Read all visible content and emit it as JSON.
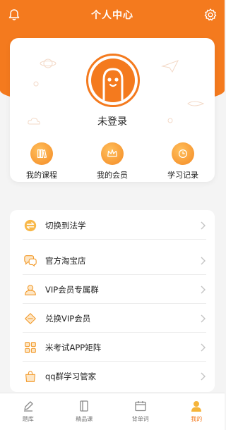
{
  "header": {
    "title": "个人中心",
    "left_icon": "bell-icon",
    "right_icon": "gear-icon"
  },
  "profile": {
    "status": "未登录",
    "quick_links": [
      {
        "label": "我的课程",
        "icon": "books-icon"
      },
      {
        "label": "我的会员",
        "icon": "crown-icon"
      },
      {
        "label": "学习记录",
        "icon": "clock-icon"
      }
    ]
  },
  "menu": {
    "items": [
      {
        "label": "切换到法学",
        "icon": "switch-icon"
      },
      {
        "label": "官方淘宝店",
        "icon": "chat-bubbles-icon"
      },
      {
        "label": "VIP会员专属群",
        "icon": "group-icon"
      },
      {
        "label": "兑换VIP会员",
        "icon": "voucher-icon"
      },
      {
        "label": "米考试APP矩阵",
        "icon": "grid-icon"
      },
      {
        "label": "qq群学习管家",
        "icon": "bag-icon"
      }
    ]
  },
  "tabbar": {
    "tabs": [
      {
        "label": "题库",
        "icon": "pen-icon"
      },
      {
        "label": "精品课",
        "icon": "book-icon"
      },
      {
        "label": "背单词",
        "icon": "calendar-icon"
      },
      {
        "label": "我的",
        "icon": "user-icon",
        "active": true
      }
    ]
  },
  "colors": {
    "accent": "#f47a1e",
    "background": "#f4f4f4"
  }
}
